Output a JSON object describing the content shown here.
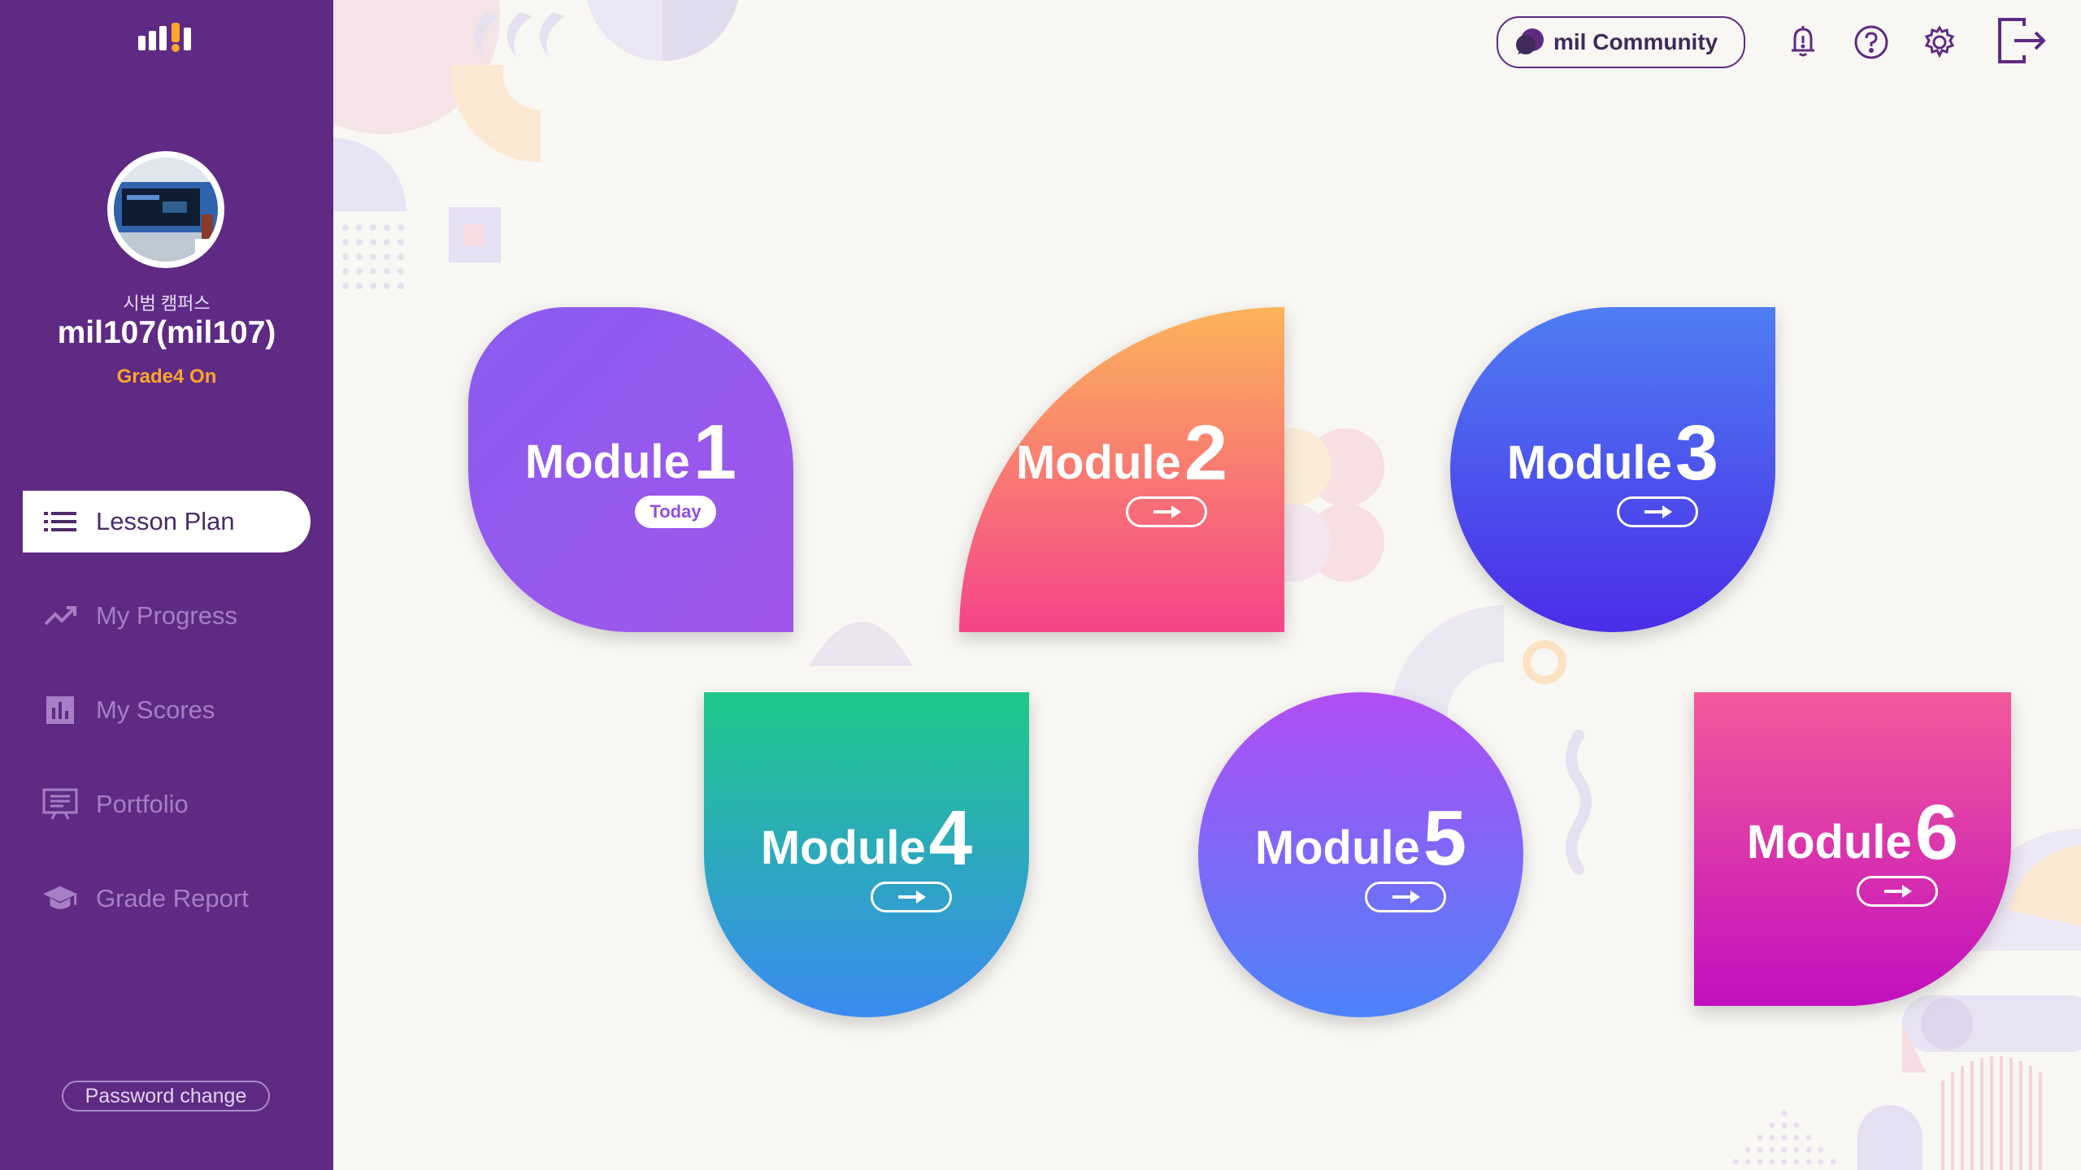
{
  "sidebar": {
    "logo": "mil logo",
    "campus": "시범 캠퍼스",
    "username": "mil107(mil107)",
    "grade": "Grade4 On",
    "nav": [
      {
        "label": "Lesson Plan",
        "icon": "list-icon",
        "active": true
      },
      {
        "label": "My Progress",
        "icon": "trending-up-icon",
        "active": false
      },
      {
        "label": "My Scores",
        "icon": "bar-chart-icon",
        "active": false
      },
      {
        "label": "Portfolio",
        "icon": "presentation-icon",
        "active": false
      },
      {
        "label": "Grade Report",
        "icon": "graduation-cap-icon",
        "active": false
      }
    ],
    "password_change": "Password change"
  },
  "header": {
    "community_label": "mil Community",
    "icons": [
      "bell-icon",
      "help-icon",
      "settings-icon",
      "logout-icon"
    ]
  },
  "modules": [
    {
      "word": "Module",
      "number": "1",
      "badge": "Today"
    },
    {
      "word": "Module",
      "number": "2"
    },
    {
      "word": "Module",
      "number": "3"
    },
    {
      "word": "Module",
      "number": "4"
    },
    {
      "word": "Module",
      "number": "5"
    },
    {
      "word": "Module",
      "number": "6"
    }
  ],
  "colors": {
    "sidebar": "#5f2a83",
    "accent_orange": "#ffa52b",
    "background": "#f9f7f4"
  }
}
